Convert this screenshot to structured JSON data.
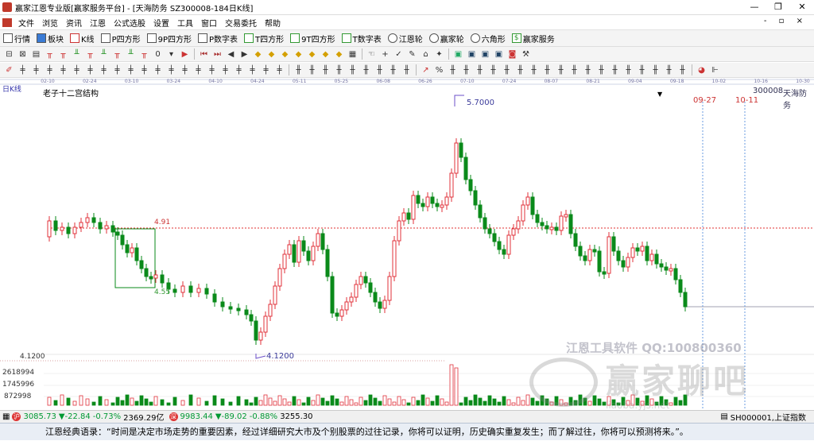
{
  "window": {
    "title": "赢家江恩专业版[赢家服务平台] - [天海防务  SZ300008-184日K线]",
    "min": "—",
    "max": "❐",
    "close": "✕"
  },
  "menu": {
    "items": [
      "文件",
      "浏览",
      "资讯",
      "江恩",
      "公式选股",
      "设置",
      "工具",
      "窗口",
      "交易委托",
      "帮助"
    ],
    "right_controls": "- ▫ ×"
  },
  "toolbar1": {
    "items": [
      "行情",
      "板块",
      "K线",
      "P四方形",
      "9P四方形",
      "P数字表",
      "T四方形",
      "9T四方形",
      "T数字表",
      "江恩轮",
      "赢家轮",
      "六角形",
      "赢家服务"
    ]
  },
  "chart": {
    "period_label": "日K线",
    "indicator_name": "老子十二宫结构",
    "dropdown_arrow": "▼",
    "stock_code": "300008",
    "stock_name": "天海防务",
    "high_label": "5.7000",
    "low_label": "4.1200",
    "box_top_label": "4.91",
    "box_bottom_label": "4.55",
    "low_axis_label": "4.1200",
    "future_date_1": "09-27",
    "future_date_2": "10-11",
    "date_ticks": [
      "02-10",
      "02-24",
      "03-10",
      "03-24",
      "04-10",
      "04-24",
      "05-11",
      "05-25",
      "06-08",
      "06-26",
      "07-10",
      "07-24",
      "08-07",
      "08-21",
      "09-04",
      "09-18",
      "10-02",
      "10-16",
      "10-30"
    ],
    "volume_ticks": [
      "2618994",
      "1745996",
      "872998"
    ],
    "watermark_text": "江恩工具软件  QQ:100800360",
    "watermark_brand": "赢家聊吧",
    "watermark_url": "liaoba.yjs.net",
    "colors": {
      "up": "#e0303a",
      "down": "#0a8a1a",
      "axis_text": "#5050a0",
      "dashed_red": "#e03030",
      "dashed_blue": "#6a9be0"
    }
  },
  "status": {
    "sh_index": "3085.73",
    "sh_change": "▼-22.84",
    "sh_pct": "-0.73%",
    "sh_amount": "2369.29亿",
    "sz_index": "9983.44",
    "sz_change": "▼-89.02",
    "sz_pct": "-0.88%",
    "sz_amount": "3255.30",
    "right_label": "SH000001,上证指数"
  },
  "quote": {
    "text": "江恩经典语录：“时间是决定市场走势的重要因素，经过详细研究大市及个别股票的过往记录，你将可以证明，历史确实重复发生；而了解过往，你将可以预测将来。”。"
  }
}
